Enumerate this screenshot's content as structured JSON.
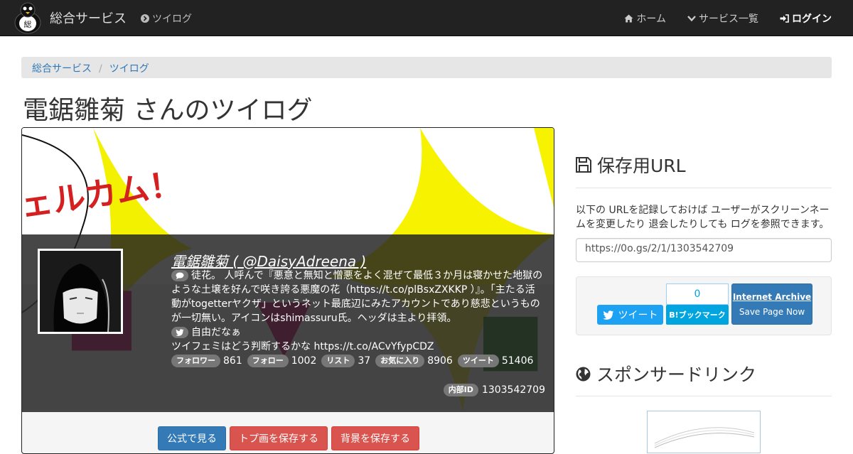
{
  "navbar": {
    "brand_logo_glyph": "総",
    "brand": "総合サービス",
    "twilog": "ツイログ",
    "home": "ホーム",
    "services": "サービス一覧",
    "login": "ログイン"
  },
  "breadcrumb": [
    "総合サービス",
    "ツイログ"
  ],
  "title": "電鋸雛菊 さんのツイログ",
  "profile": {
    "banner_text": "ェルカム！",
    "name": "電鋸雛菊 ( @DaisyAdreena )",
    "bio": "徒花。 人呼んで『悪意と無知と憎悪をよく混ぜて最低３か月は寝かせた地獄のような土壌を好んで咲き誇る悪魔の花（https://t.co/plBsxZXKKP ）』。「主たる活動がtogetterヤクザ」というネット最底辺にみたアカウントであり慈悲というものが一切無い。アイコンはshimassuru氏。ヘッダは主より拝領。",
    "location": "自由だなぁ",
    "url_line": "ツイフェミはどう判断するかな https://t.co/ACvYfypCDZ",
    "stats": [
      {
        "label": "フォロワー",
        "value": "861"
      },
      {
        "label": "フォロー",
        "value": "1002"
      },
      {
        "label": "リスト",
        "value": "37"
      },
      {
        "label": "お気に入り",
        "value": "8906"
      },
      {
        "label": "ツイート",
        "value": "51406"
      }
    ],
    "internal_label": "内部ID",
    "internal_id": "1303542709"
  },
  "actions": {
    "official": "公式で見る",
    "save_icon": "トプ画を保存する",
    "save_banner": "背景を保存する"
  },
  "sidebar": {
    "save_heading": "保存用URL",
    "save_desc": "以下の URLを記録しておけば ユーザーがスクリーンネームを変更したり 退会したりしても ログを参照できます。",
    "save_url": "https://0o.gs/2/1/1303542709",
    "tweet": "ツイート",
    "hatena_count": "0",
    "hatena": "B!ブックマーク",
    "ia_title": "Internet Archive",
    "ia_sub": "Save Page Now",
    "sponsor_heading": "スポンサードリンク"
  }
}
